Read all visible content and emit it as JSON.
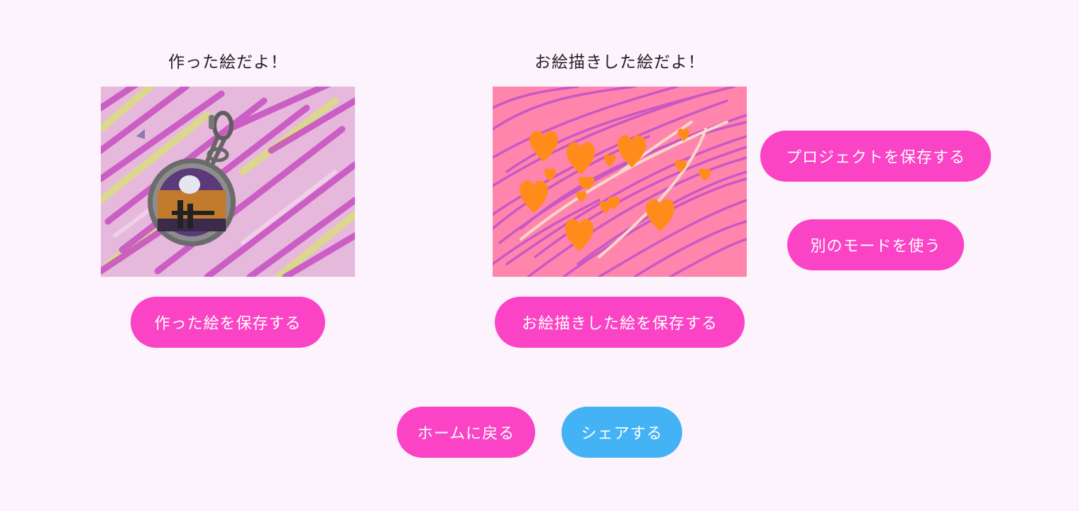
{
  "left": {
    "caption": "作った絵だよ！",
    "save_label": "作った絵を保存する"
  },
  "right": {
    "caption": "お絵描きした絵だよ！",
    "save_label": "お絵描きした絵を保存する"
  },
  "side_actions": {
    "save_project_label": "プロジェクトを保存する",
    "other_mode_label": "別のモードを使う"
  },
  "footer": {
    "home_label": "ホームに戻る",
    "share_label": "シェアする"
  },
  "colors": {
    "background": "#fcf3fd",
    "primary_button": "#fa43c5",
    "share_button": "#44b3f5",
    "drawing_background": "#ff85ad",
    "heart": "#ff8c1a"
  }
}
